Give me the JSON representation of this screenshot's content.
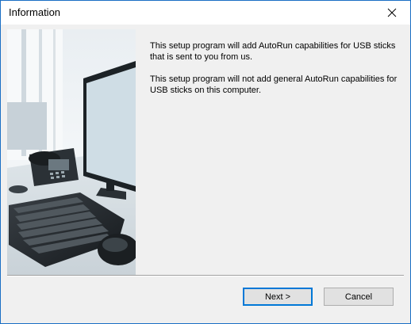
{
  "window": {
    "title": "Information"
  },
  "icons": {
    "close": "close-icon",
    "side_image": "desk-keyboard-phone-monitor-photo"
  },
  "message": {
    "paragraph1": "This setup program will add AutoRun capabilities for USB sticks that is sent to you from us.",
    "paragraph2": "This setup program will not add general AutoRun capabilities for USB sticks on this computer."
  },
  "buttons": {
    "next_label": "Next >",
    "cancel_label": "Cancel"
  },
  "colors": {
    "accent": "#0078d7",
    "window_border": "#1a6fc4",
    "dialog_bg": "#f0f0f0"
  }
}
